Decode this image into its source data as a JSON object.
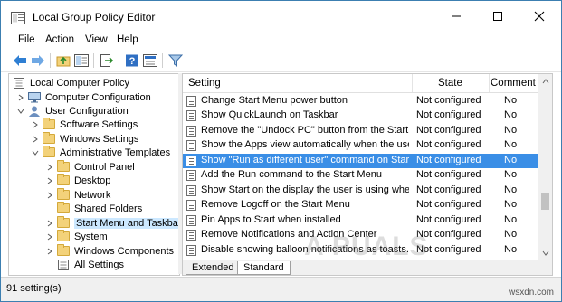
{
  "window": {
    "title": "Local Group Policy Editor"
  },
  "menu": [
    "File",
    "Action",
    "View",
    "Help"
  ],
  "toolbar": {
    "buttons": [
      "back-icon",
      "forward-icon",
      "up-folder-icon",
      "show-hide-tree-icon",
      "export-list-icon",
      "help-icon",
      "properties-icon",
      "filter-icon"
    ]
  },
  "tree": {
    "root": "Local Computer Policy",
    "computer_config": "Computer Configuration",
    "user_config": "User Configuration",
    "software_settings": "Software Settings",
    "windows_settings": "Windows Settings",
    "admin_templates": "Administrative Templates",
    "control_panel": "Control Panel",
    "desktop": "Desktop",
    "network": "Network",
    "shared_folders": "Shared Folders",
    "start_menu": "Start Menu and Taskbar",
    "system": "System",
    "windows_components": "Windows Components",
    "all_settings": "All Settings"
  },
  "list": {
    "headers": {
      "setting": "Setting",
      "state": "State",
      "comment": "Comment"
    },
    "rows": [
      {
        "setting": "Change Start Menu power button",
        "state": "Not configured",
        "comment": "No"
      },
      {
        "setting": "Show QuickLaunch on Taskbar",
        "state": "Not configured",
        "comment": "No"
      },
      {
        "setting": "Remove the \"Undock PC\" button from the Start ...",
        "state": "Not configured",
        "comment": "No"
      },
      {
        "setting": "Show the Apps view automatically when the user...",
        "state": "Not configured",
        "comment": "No"
      },
      {
        "setting": "Show \"Run as different user\" command on Start",
        "state": "Not configured",
        "comment": "No"
      },
      {
        "setting": "Add the Run command to the Start Menu",
        "state": "Not configured",
        "comment": "No"
      },
      {
        "setting": "Show Start on the display the user is using when ...",
        "state": "Not configured",
        "comment": "No"
      },
      {
        "setting": "Remove Logoff on the Start Menu",
        "state": "Not configured",
        "comment": "No"
      },
      {
        "setting": "Pin Apps to Start when installed",
        "state": "Not configured",
        "comment": "No"
      },
      {
        "setting": "Remove Notifications and Action Center",
        "state": "Not configured",
        "comment": "No"
      },
      {
        "setting": "Disable showing balloon notifications as toasts.",
        "state": "Not configured",
        "comment": "No"
      }
    ],
    "selected_index": 4
  },
  "tabs": {
    "extended": "Extended",
    "standard": "Standard"
  },
  "status": {
    "text": "91 setting(s)"
  },
  "watermark": {
    "text": "A PUALS",
    "site": "wsxdn.com"
  },
  "colors": {
    "selection": "#3a8ee6",
    "tree_selection": "#cce8ff",
    "accent_border": "#3c7fb1"
  }
}
